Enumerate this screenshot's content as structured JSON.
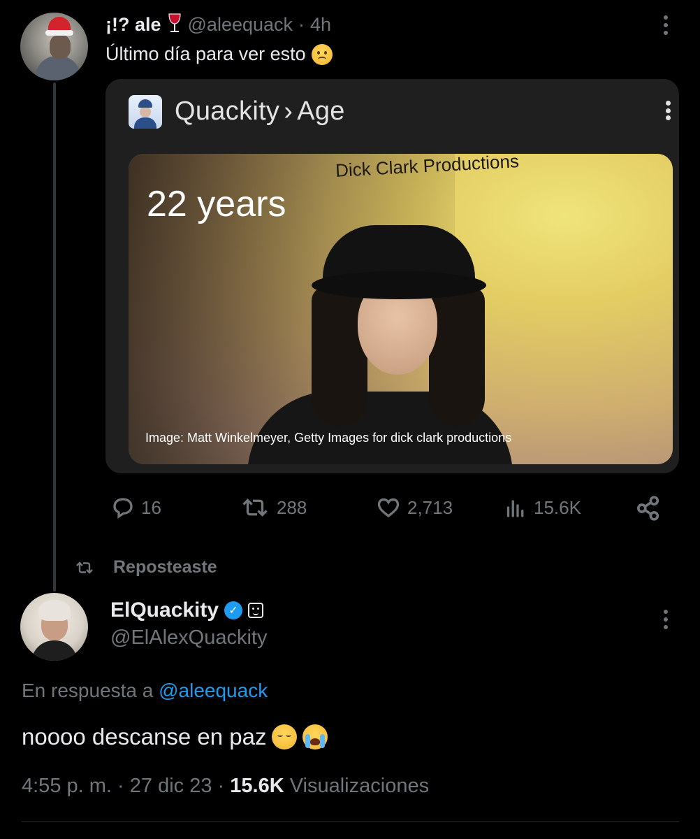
{
  "tweet": {
    "author_name": "¡!? ale",
    "author_emoji": "wine-glass-icon",
    "author_handle": "@aleequack",
    "time_sep": "·",
    "time_ago": "4h",
    "text": "Último día para ver esto",
    "text_emoji": "frowning-face-icon",
    "card": {
      "title_subject": "Quackity",
      "title_sep": "›",
      "title_topic": "Age",
      "age_text": "22 years",
      "backdrop_text": "Dick Clark Productions",
      "image_credit": "Image: Matt Winkelmeyer, Getty Images for dick clark productions"
    },
    "actions": {
      "replies": "16",
      "reposts": "288",
      "likes": "2,713",
      "views": "15.6K"
    }
  },
  "repost_label": "Reposteaste",
  "reply": {
    "author_name": "ElQuackity",
    "author_handle": "@ElAlexQuackity",
    "reply_prefix": "En respuesta a",
    "reply_mention": "@aleequack",
    "text": "noooo descanse en paz",
    "time": "4:55 p. m.",
    "sep1": "·",
    "date": "27 dic 23",
    "sep2": "·",
    "views_count": "15.6K",
    "views_label": "Visualizaciones"
  },
  "colors": {
    "background": "#000000",
    "text_primary": "#e7e9ea",
    "text_secondary": "#71767b",
    "accent": "#1d9bf0",
    "card_bg": "#1f1f1f"
  }
}
